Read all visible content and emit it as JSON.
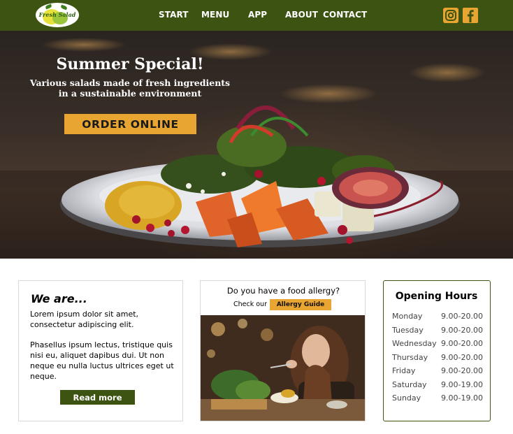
{
  "colors": {
    "nav_bg": "#3d5311",
    "accent": "#e9a532",
    "button_green": "#3d5311"
  },
  "logo": {
    "text": "Fresh Salad"
  },
  "nav": {
    "links": [
      {
        "label": "START"
      },
      {
        "label": "MENU"
      },
      {
        "label": "APP"
      },
      {
        "label": "ABOUT"
      },
      {
        "label": "CONTACT"
      }
    ],
    "social_icons": [
      "instagram-icon",
      "facebook-icon"
    ]
  },
  "hero": {
    "title": "Summer Special!",
    "subtitle_lines": [
      "Various salads made of fresh ingredients",
      "in a sustainable environment"
    ],
    "cta_label": "ORDER ONLINE"
  },
  "about": {
    "heading": "We are...",
    "paragraph1": "Lorem ipsum dolor sit amet, consectetur adipiscing elit.",
    "paragraph2": "Phasellus ipsum lectus, tristique quis nisi eu, aliquet dapibus dui. Ut non neque eu nulla luctus ultrices eget ut neque.",
    "button_label": "Read more"
  },
  "allergy": {
    "question": "Do you have a food allergy?",
    "prefix": "Check our",
    "button_label": "Allergy Guide"
  },
  "hours": {
    "heading": "Opening Hours",
    "rows": [
      {
        "day": "Monday",
        "time": "9.00-20.00"
      },
      {
        "day": "Tuesday",
        "time": "9.00-20.00"
      },
      {
        "day": "Wednesday",
        "time": "9.00-20.00"
      },
      {
        "day": "Thursday",
        "time": "9.00-20.00"
      },
      {
        "day": "Friday",
        "time": "9.00-20.00"
      },
      {
        "day": "Saturday",
        "time": "9.00-19.00"
      },
      {
        "day": "Sunday",
        "time": "9.00-19.00"
      }
    ]
  }
}
